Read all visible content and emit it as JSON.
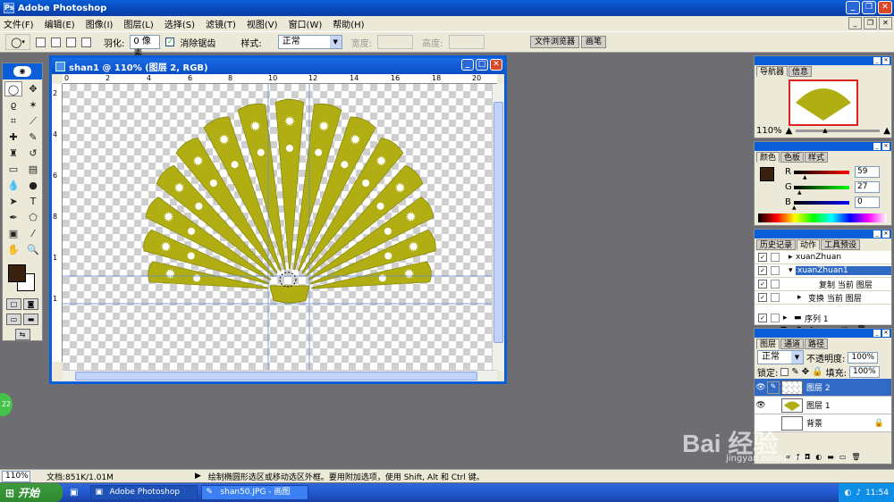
{
  "app": {
    "title": "Adobe Photoshop"
  },
  "menu": [
    "文件(F)",
    "编辑(E)",
    "图像(I)",
    "图层(L)",
    "选择(S)",
    "滤镜(T)",
    "视图(V)",
    "窗口(W)",
    "帮助(H)"
  ],
  "options": {
    "feather_label": "羽化:",
    "feather_value": "0 像素",
    "antialias_label": "消除锯齿",
    "style_label": "样式:",
    "style_value": "正常",
    "width_label": "宽度:",
    "height_label": "高度:",
    "file_browser_tab": "文件浏览器",
    "brush_tab": "画笔"
  },
  "document": {
    "title": "shan1 @ 110% (图层 2, RGB)",
    "ruler_top": [
      "0",
      "2",
      "4",
      "6",
      "8",
      "10",
      "12",
      "14",
      "16",
      "18",
      "20"
    ],
    "ruler_left": [
      "2",
      "4",
      "6",
      "8",
      "1",
      "1"
    ]
  },
  "navigator": {
    "tabs": [
      "导航器",
      "信息"
    ],
    "zoom": "110%"
  },
  "color": {
    "tabs": [
      "颜色",
      "色板",
      "样式"
    ],
    "r_label": "R",
    "r_value": "59",
    "r_fraction": 0.23,
    "g_label": "G",
    "g_value": "27",
    "g_fraction": 0.11,
    "b_label": "B",
    "b_value": "0",
    "b_fraction": 0.0
  },
  "actions": {
    "tabs": [
      "历史记录",
      "动作",
      "工具预设"
    ],
    "rows": [
      {
        "label": "xuanZhuan",
        "checked": true,
        "indent": 1
      },
      {
        "label": "xuanZhuan1",
        "checked": true,
        "indent": 1,
        "selected": true
      },
      {
        "label": "复制 当前 图层",
        "checked": true,
        "indent": 2
      },
      {
        "label": "变换 当前 图层",
        "checked": true,
        "indent": 2
      },
      {
        "label": "序列 1",
        "checked": true,
        "indent": 0
      }
    ]
  },
  "layers": {
    "tabs": [
      "图层",
      "通道",
      "路径"
    ],
    "blend_mode": "正常",
    "opacity_label": "不透明度:",
    "opacity_value": "100%",
    "lock_label": "锁定:",
    "fill_label": "填充:",
    "fill_value": "100%",
    "rows": [
      {
        "name": "图层 2",
        "selected": true
      },
      {
        "name": "图层 1",
        "selected": false
      },
      {
        "name": "背景",
        "selected": false
      }
    ]
  },
  "status": {
    "zoom": "110%",
    "doc_info": "文档:851K/1.01M",
    "hint": "绘制椭圆形选区或移动选区外框。要用附加选项，使用 Shift, Alt 和 Ctrl 键。"
  },
  "taskbar": {
    "start": "开始",
    "tasks": [
      "Adobe Photoshop",
      "shan50.JPG - 画图"
    ],
    "clock": "11:54"
  },
  "watermark": {
    "main": "Bai 经验",
    "sub": "jingyan.baidu.com"
  },
  "misc": {
    "side_badge": "22"
  },
  "colors": {
    "fan": "#b0ae12",
    "fan_dark": "#8a8a0a",
    "foreground": "#3a200e",
    "accent": "#0a5fd8"
  }
}
